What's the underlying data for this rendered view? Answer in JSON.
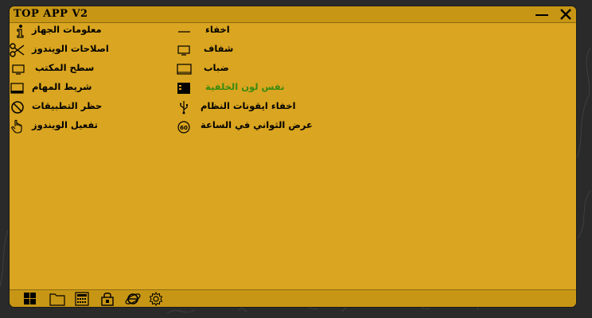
{
  "window": {
    "title": "TOP APP V2"
  },
  "left_menu": [
    {
      "label": "معلومات الجهاز",
      "icon": "info-icon"
    },
    {
      "label": "اصلاحات الويندوز",
      "icon": "scissors-icon"
    },
    {
      "label": "سطح المكتب",
      "icon": "desktop-icon"
    },
    {
      "label": "شريط المهام",
      "icon": "taskbar-icon"
    },
    {
      "label": "حظر التطبيقات",
      "icon": "block-icon"
    },
    {
      "label": "تفعيل الويندوز",
      "icon": "hand-pointer-icon"
    }
  ],
  "right_menu": [
    {
      "label": "اخفاء",
      "icon": "dash-icon"
    },
    {
      "label": "شفاف",
      "icon": "monitor-icon"
    },
    {
      "label": "ضباب",
      "icon": "monitor-frame-icon"
    },
    {
      "label": "نفس لون الخلفية",
      "icon": "window-list-icon",
      "color": "#3a8a10"
    },
    {
      "label": "اخفاء ايقونات  النظام",
      "icon": "usb-icon"
    },
    {
      "label": "عرض الثواني في الساعة",
      "icon": "clock-seconds-icon"
    }
  ],
  "bottom_toolbar": [
    {
      "icon": "windows-icon"
    },
    {
      "icon": "folder-icon"
    },
    {
      "icon": "calculator-icon"
    },
    {
      "icon": "lock-icon"
    },
    {
      "icon": "internet-explorer-icon"
    },
    {
      "icon": "settings-gear-icon"
    }
  ]
}
